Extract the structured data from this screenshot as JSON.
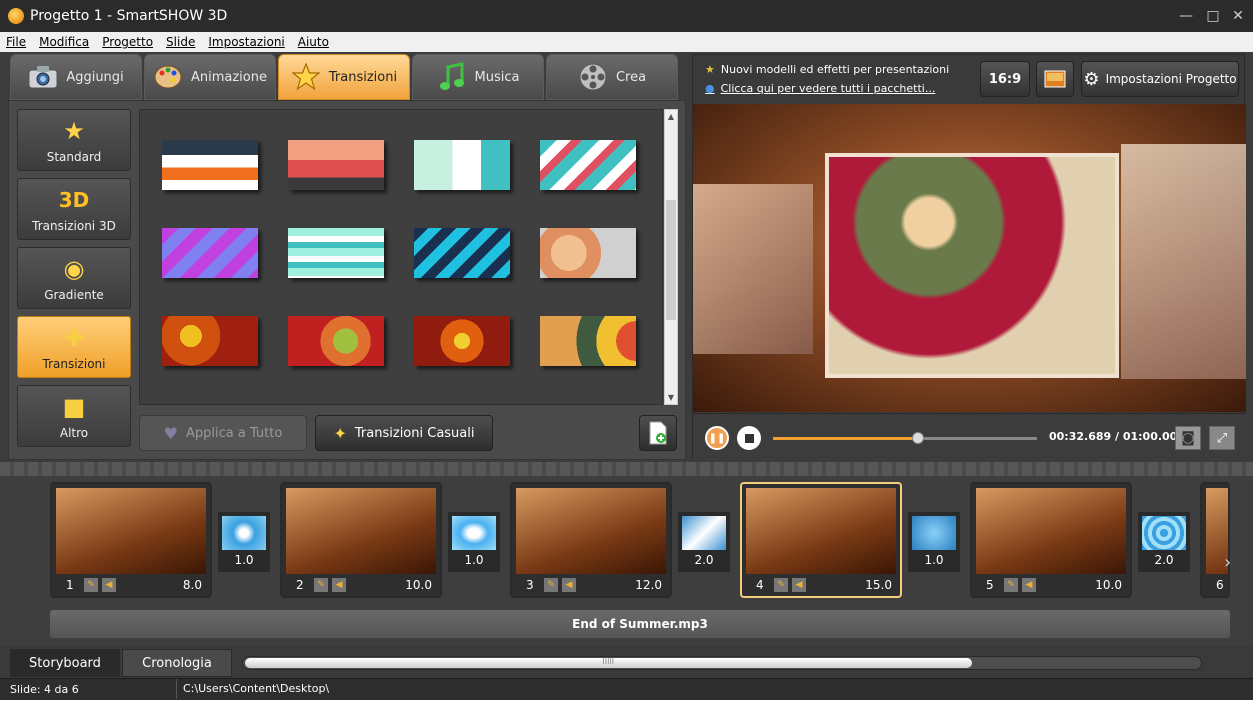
{
  "window": {
    "title": "Progetto 1 - SmartSHOW 3D",
    "controls": [
      "—",
      "□",
      "✕"
    ]
  },
  "menu": [
    "File",
    "Modifica",
    "Progetto",
    "Slide",
    "Impostazioni",
    "Aiuto"
  ],
  "tabs": [
    {
      "label": "Aggiungi",
      "icon": "camera-icon"
    },
    {
      "label": "Animazione",
      "icon": "palette-icon"
    },
    {
      "label": "Transizioni",
      "icon": "star-icon",
      "active": true
    },
    {
      "label": "Musica",
      "icon": "music-note-icon"
    },
    {
      "label": "Crea",
      "icon": "film-reel-icon"
    }
  ],
  "categories": [
    {
      "label": "Standard",
      "icon": "★"
    },
    {
      "label": "Transizioni 3D",
      "icon": "3D"
    },
    {
      "label": "Gradiente",
      "icon": "◉"
    },
    {
      "label": "Transizioni",
      "icon": "✚",
      "active": true
    },
    {
      "label": "Altro",
      "icon": "■"
    }
  ],
  "buttons": {
    "apply_all": "Applica a Tutto",
    "random": "Transizioni Casuali"
  },
  "promo": {
    "line1": "Nuovi modelli ed effetti per presentazioni",
    "line2": "Clicca qui per vedere tutti i pacchetti..."
  },
  "topbar": {
    "aspect": "16:9",
    "settings": "Impostazioni Progetto"
  },
  "player": {
    "time": "00:32.689 / 01:00.000",
    "progress": 0.55
  },
  "slides": [
    {
      "num": "1",
      "duration": "8.0"
    },
    {
      "num": "2",
      "duration": "10.0"
    },
    {
      "num": "3",
      "duration": "12.0"
    },
    {
      "num": "4",
      "duration": "15.0",
      "selected": true
    },
    {
      "num": "5",
      "duration": "10.0"
    },
    {
      "num": "6",
      "duration": ""
    }
  ],
  "transitions": [
    "1.0",
    "1.0",
    "2.0",
    "1.0",
    "2.0"
  ],
  "music": {
    "track": "End of Summer.mp3"
  },
  "bottom_tabs": {
    "storyboard": "Storyboard",
    "timeline": "Cronologia"
  },
  "scrollbar": {
    "grip": "IIIII",
    "fill": 0.76
  },
  "status": {
    "slide": "Slide: 4 da 6",
    "path": "C:\\Users\\Content\\Desktop\\"
  }
}
